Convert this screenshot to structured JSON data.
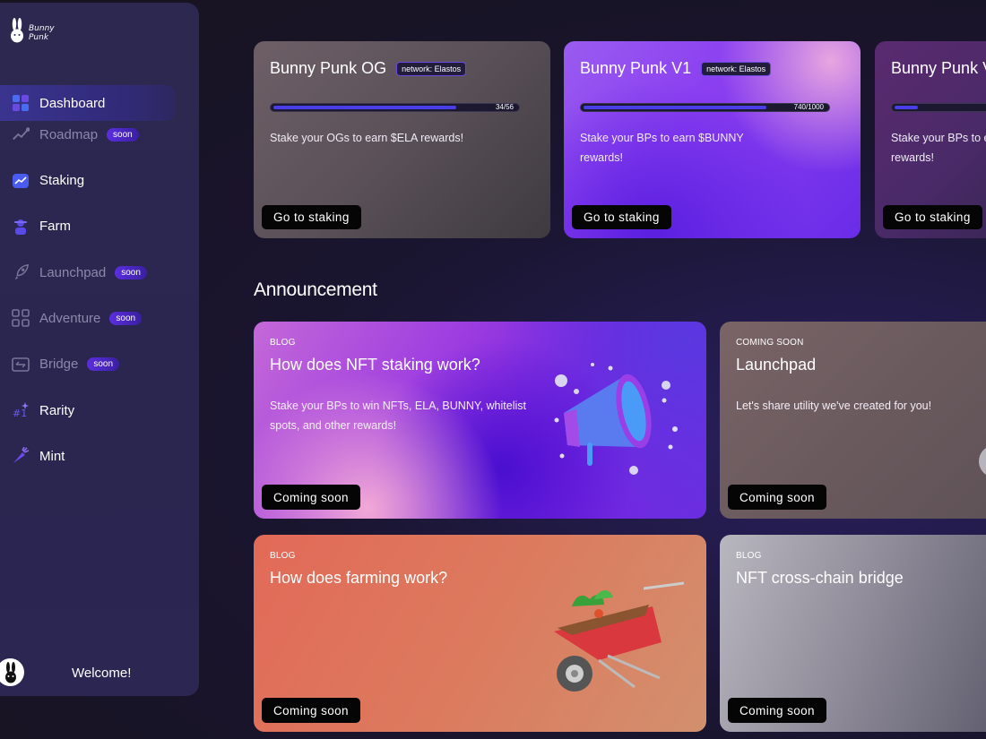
{
  "sidebar": {
    "logo_line1": "Bunny",
    "logo_line2": "Punk",
    "items": [
      {
        "label": "Dashboard",
        "icon": "dashboard-icon",
        "active": true
      },
      {
        "label": "Roadmap",
        "icon": "roadmap-icon",
        "badge": "soon"
      },
      {
        "label": "Staking",
        "icon": "staking-icon"
      },
      {
        "label": "Farm",
        "icon": "farm-icon"
      },
      {
        "label": "Launchpad",
        "icon": "rocket-icon",
        "badge": "soon"
      },
      {
        "label": "Adventure",
        "icon": "adventure-icon",
        "badge": "soon"
      },
      {
        "label": "Bridge",
        "icon": "bridge-icon",
        "badge": "soon"
      },
      {
        "label": "Rarity",
        "icon": "rarity-icon"
      },
      {
        "label": "Mint",
        "icon": "carrot-icon"
      }
    ],
    "welcome": "Welcome!"
  },
  "staking_cards": [
    {
      "title": "Bunny Punk OG",
      "network": "network: Elastos",
      "progress_text": "34/56",
      "progress_value": 0.65,
      "description": "Stake your OGs to earn $ELA rewards!",
      "button": "Go to staking"
    },
    {
      "title": "Bunny Punk V1",
      "network": "network: Elastos",
      "progress_text": "740/1000",
      "progress_value": 0.74,
      "description": "Stake your BPs to earn $BUNNY rewards!",
      "button": "Go to staking"
    },
    {
      "title": "Bunny Punk V",
      "progress_value": 0.1,
      "description": "Stake your BPs to e rewards!",
      "button": "Go to staking"
    }
  ],
  "announcement_title": "Announcement",
  "announcements": [
    {
      "category": "BLOG",
      "title": "How does NFT staking work?",
      "description": "Stake your BPs to win NFTs, ELA, BUNNY, whitelist spots, and other rewards!",
      "button": "Coming soon",
      "art": "megaphone-icon"
    },
    {
      "category": "COMING SOON",
      "title": "Launchpad",
      "description": "Let's share utility we've created for you!",
      "button": "Coming soon"
    },
    {
      "category": "BLOG",
      "title": "How does farming work?",
      "description": "",
      "button": "Coming soon",
      "art": "wheelbarrow-icon"
    },
    {
      "category": "BLOG",
      "title": "NFT cross-chain bridge",
      "description": "",
      "button": "Coming soon"
    }
  ],
  "colors": {
    "accent": "#4a3ee8",
    "sidebar_bg": "#2c2850",
    "button_bg": "#050505",
    "badge": "#5b2ee0"
  }
}
